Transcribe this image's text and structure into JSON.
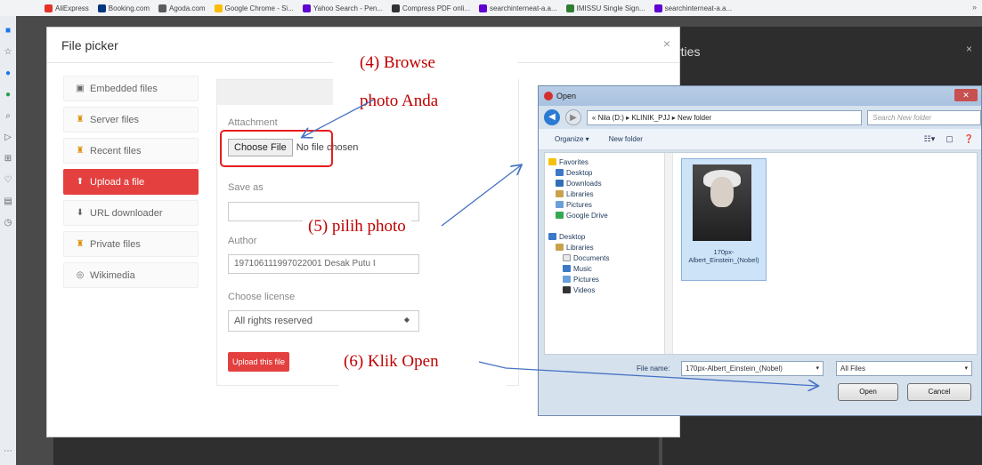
{
  "bookmarks": [
    {
      "label": "AliExpress",
      "color": "#e43226"
    },
    {
      "label": "Booking.com",
      "color": "#003580"
    },
    {
      "label": "Agoda.com",
      "color": "#5c5c5c"
    },
    {
      "label": "Google Chrome - Si...",
      "color": "#fbbc05"
    },
    {
      "label": "Yahoo Search - Pen...",
      "color": "#6001d2"
    },
    {
      "label": "Compress PDF onli...",
      "color": "#333333"
    },
    {
      "label": "searchinterneat-a.a...",
      "color": "#6001d2"
    },
    {
      "label": "IMISSU Single Sign...",
      "color": "#2e7d32"
    },
    {
      "label": "searchinterneat-a.a...",
      "color": "#6001d2"
    }
  ],
  "bookmarks_more": "»",
  "background": {
    "panel_title": "rties",
    "close": "×"
  },
  "modal": {
    "title": "File picker",
    "close": "×",
    "repositories": [
      {
        "label": "Embedded files",
        "icon": "embed-icon"
      },
      {
        "label": "Server files",
        "icon": "server-icon"
      },
      {
        "label": "Recent files",
        "icon": "recent-icon"
      },
      {
        "label": "Upload a file",
        "icon": "upload-icon"
      },
      {
        "label": "URL downloader",
        "icon": "url-icon"
      },
      {
        "label": "Private files",
        "icon": "private-icon"
      },
      {
        "label": "Wikimedia",
        "icon": "wikimedia-icon"
      }
    ],
    "form": {
      "attachment_label": "Attachment",
      "choose_file": "Choose File",
      "no_file": "No file chosen",
      "saveas_label": "Save as",
      "author_label": "Author",
      "author_value": "197106111997022001 Desak Putu I",
      "license_label": "Choose license",
      "license_value": "All rights reserved",
      "upload_button": "Upload this file"
    }
  },
  "annotations": {
    "step4_line1": "(4)        Browse",
    "step4_line2": "photo Anda",
    "step5": "(5) pilih photo",
    "step6": "(6) Klik Open"
  },
  "open_dialog": {
    "title": "Open",
    "address": "« Nila (D:) ▸ KLINIK_PJJ ▸ New folder",
    "search_placeholder": "Search New folder",
    "organize": "Organize ▾",
    "new_folder": "New folder",
    "nav_items": [
      {
        "label": "Favorites",
        "icon": "star-icon",
        "indent": 0
      },
      {
        "label": "Desktop",
        "icon": "desktop-icon",
        "indent": 1
      },
      {
        "label": "Downloads",
        "icon": "downloads-icon",
        "indent": 1
      },
      {
        "label": "Libraries",
        "icon": "libraries-icon",
        "indent": 1
      },
      {
        "label": "Pictures",
        "icon": "pictures-icon",
        "indent": 1
      },
      {
        "label": "Google Drive",
        "icon": "drive-icon",
        "indent": 1
      },
      {
        "label": "",
        "icon": "",
        "indent": 0
      },
      {
        "label": "Desktop",
        "icon": "desktop-icon",
        "indent": 0
      },
      {
        "label": "Libraries",
        "icon": "libraries-icon",
        "indent": 1
      },
      {
        "label": "Documents",
        "icon": "documents-icon",
        "indent": 2
      },
      {
        "label": "Music",
        "icon": "music-icon",
        "indent": 2
      },
      {
        "label": "Pictures",
        "icon": "pictures-icon",
        "indent": 2
      },
      {
        "label": "Videos",
        "icon": "videos-icon",
        "indent": 2
      }
    ],
    "file_label": "170px-Albert_Einstein_(Nobel)",
    "filename_label": "File name:",
    "filename_value": "170px-Albert_Einstein_(Nobel)",
    "filetype_value": "All Files",
    "open_button": "Open",
    "cancel_button": "Cancel"
  }
}
